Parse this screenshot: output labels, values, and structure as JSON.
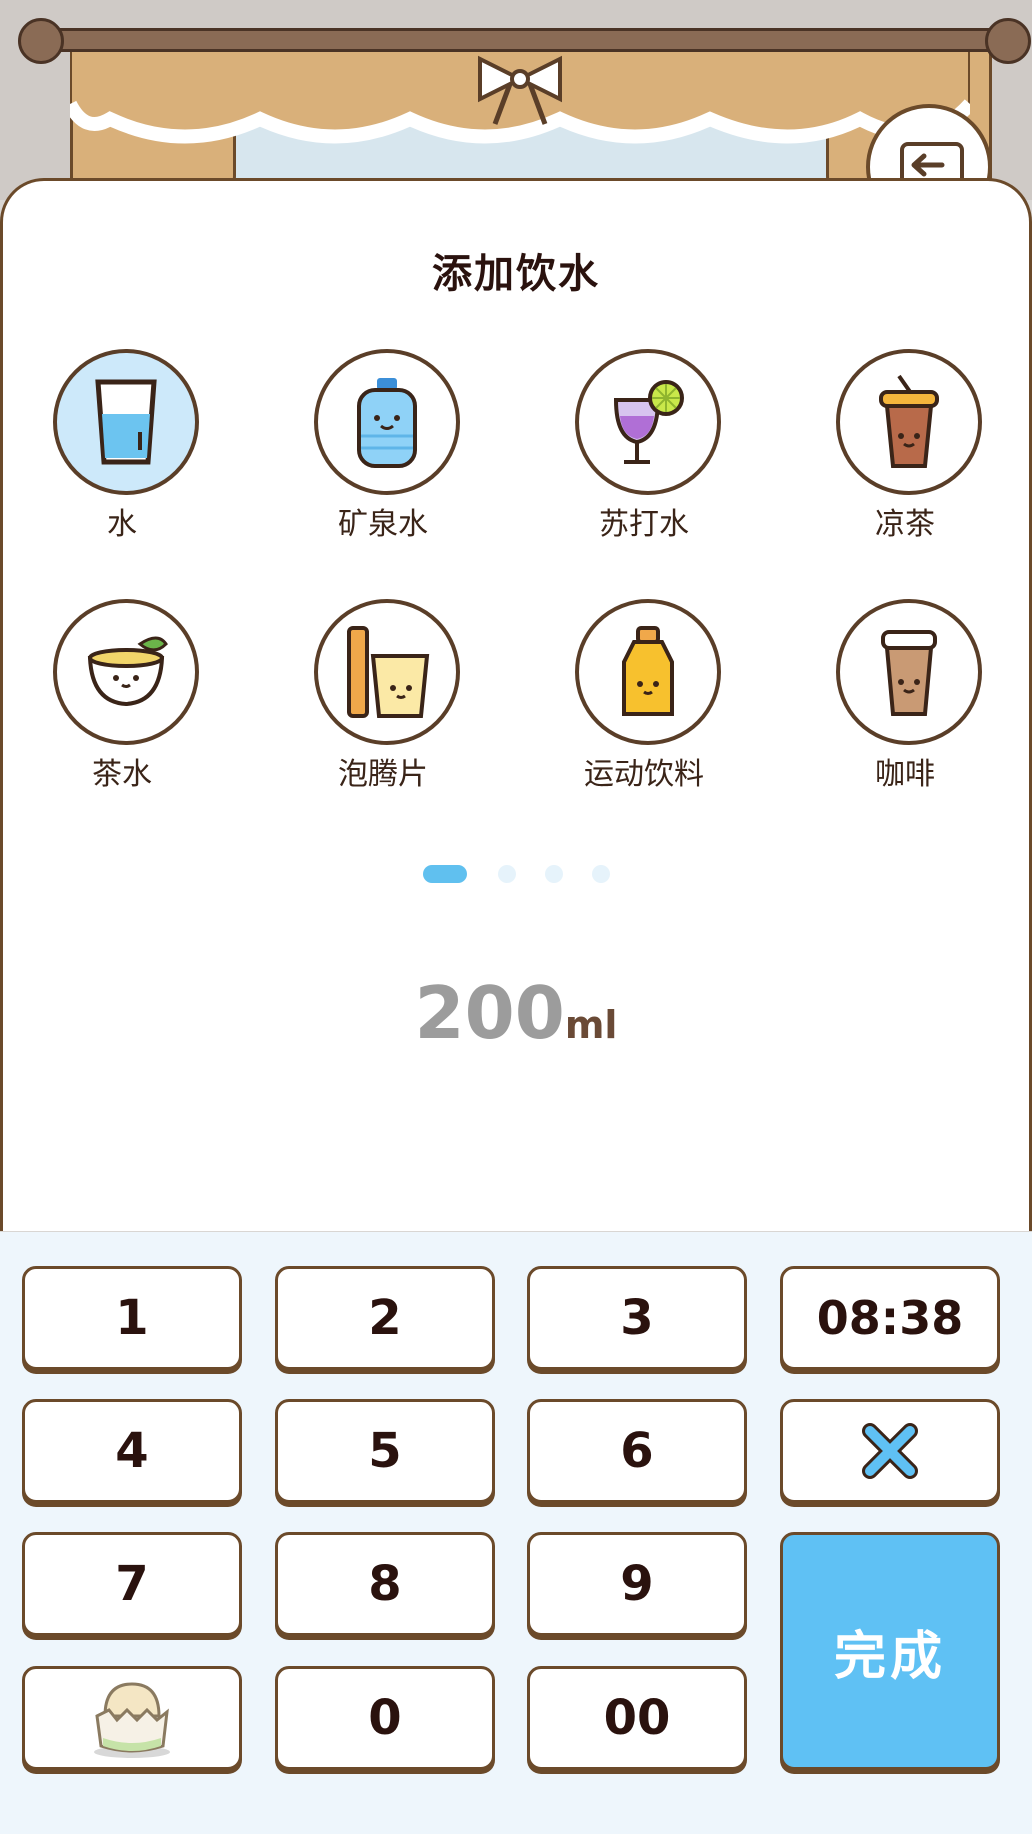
{
  "title": "添加饮水",
  "drinks": [
    {
      "label": "水",
      "icon": "water-glass-icon",
      "selected": true
    },
    {
      "label": "矿泉水",
      "icon": "mineral-water-bottle-icon",
      "selected": false
    },
    {
      "label": "苏打水",
      "icon": "soda-glass-icon",
      "selected": false
    },
    {
      "label": "凉茶",
      "icon": "iced-tea-cup-icon",
      "selected": false
    },
    {
      "label": "茶水",
      "icon": "tea-cup-icon",
      "selected": false
    },
    {
      "label": "泡腾片",
      "icon": "effervescent-tablet-icon",
      "selected": false
    },
    {
      "label": "运动饮料",
      "icon": "sports-drink-bottle-icon",
      "selected": false
    },
    {
      "label": "咖啡",
      "icon": "coffee-cup-icon",
      "selected": false
    }
  ],
  "pagination": {
    "pages": 4,
    "current": 1
  },
  "amount": {
    "value": "200",
    "unit": "ml"
  },
  "keypad": {
    "k1": "1",
    "k2": "2",
    "k3": "3",
    "time": "08:38",
    "k4": "4",
    "k5": "5",
    "k6": "6",
    "k7": "7",
    "k8": "8",
    "k9": "9",
    "k0": "0",
    "k00": "00",
    "done": "完成",
    "clear_icon": "clear-x-icon",
    "mascot_icon": "egg-mascot-icon"
  },
  "colors": {
    "accent": "#5fc1f4",
    "border": "#6b4a2a",
    "selected_bg": "#cde9fa"
  }
}
